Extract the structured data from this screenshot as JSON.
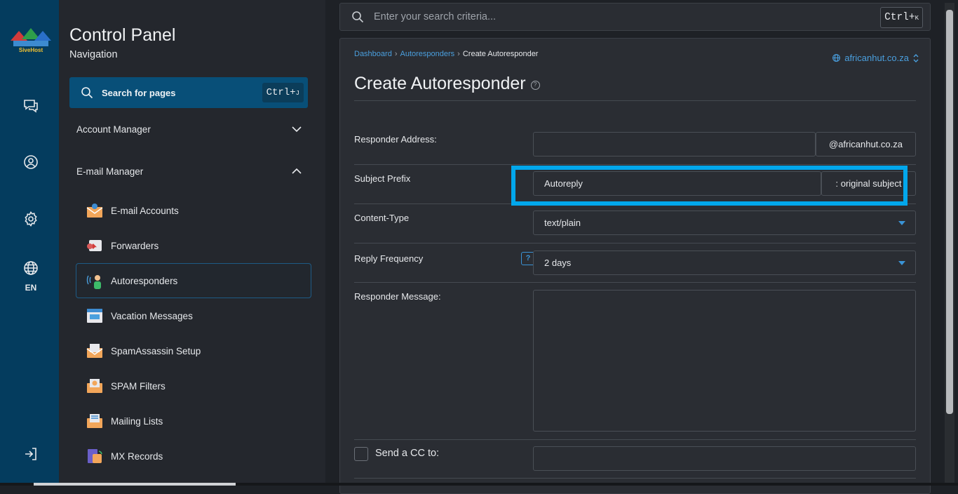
{
  "app": {
    "brand_logo_text": "SiveHost",
    "language": "EN"
  },
  "nav": {
    "title": "Control Panel",
    "subtitle": "Navigation",
    "search_label": "Search for pages",
    "search_shortcut_main": "Ctrl+",
    "search_shortcut_key": "J",
    "sections": [
      {
        "label": "Account Manager",
        "expanded": false
      },
      {
        "label": "E-mail Manager",
        "expanded": true
      }
    ],
    "items": [
      {
        "label": "E-mail Accounts",
        "icon": "email-accounts-icon"
      },
      {
        "label": "Forwarders",
        "icon": "forwarders-icon"
      },
      {
        "label": "Autoresponders",
        "icon": "autoresponders-icon",
        "active": true
      },
      {
        "label": "Vacation Messages",
        "icon": "vacation-messages-icon"
      },
      {
        "label": "SpamAssassin Setup",
        "icon": "spamassassin-icon"
      },
      {
        "label": "SPAM Filters",
        "icon": "spam-filters-icon"
      },
      {
        "label": "Mailing Lists",
        "icon": "mailing-lists-icon"
      },
      {
        "label": "MX Records",
        "icon": "mx-records-icon"
      }
    ]
  },
  "topbar": {
    "search_placeholder": "Enter your search criteria...",
    "shortcut_main": "Ctrl+",
    "shortcut_key": "K"
  },
  "page": {
    "breadcrumb": [
      "Dashboard",
      "Autoresponders",
      "Create Autoresponder"
    ],
    "domain": "africanhut.co.za",
    "title": "Create Autoresponder",
    "form": {
      "responder_address_label": "Responder Address:",
      "responder_address_value": "",
      "responder_address_suffix": "@africanhut.co.za",
      "subject_prefix_label": "Subject Prefix",
      "subject_prefix_value": "Autoreply",
      "subject_prefix_suffix": ": original subject",
      "content_type_label": "Content-Type",
      "content_type_value": "text/plain",
      "reply_frequency_label": "Reply Frequency",
      "reply_frequency_help": "?",
      "reply_frequency_value": "2 days",
      "responder_message_label": "Responder Message:",
      "send_cc_label": "Send a CC to:",
      "send_cc_checked": false
    }
  },
  "colors": {
    "rail_bg": "#043c5e",
    "accent": "#4a9fde",
    "highlight": "#02a7ec"
  }
}
